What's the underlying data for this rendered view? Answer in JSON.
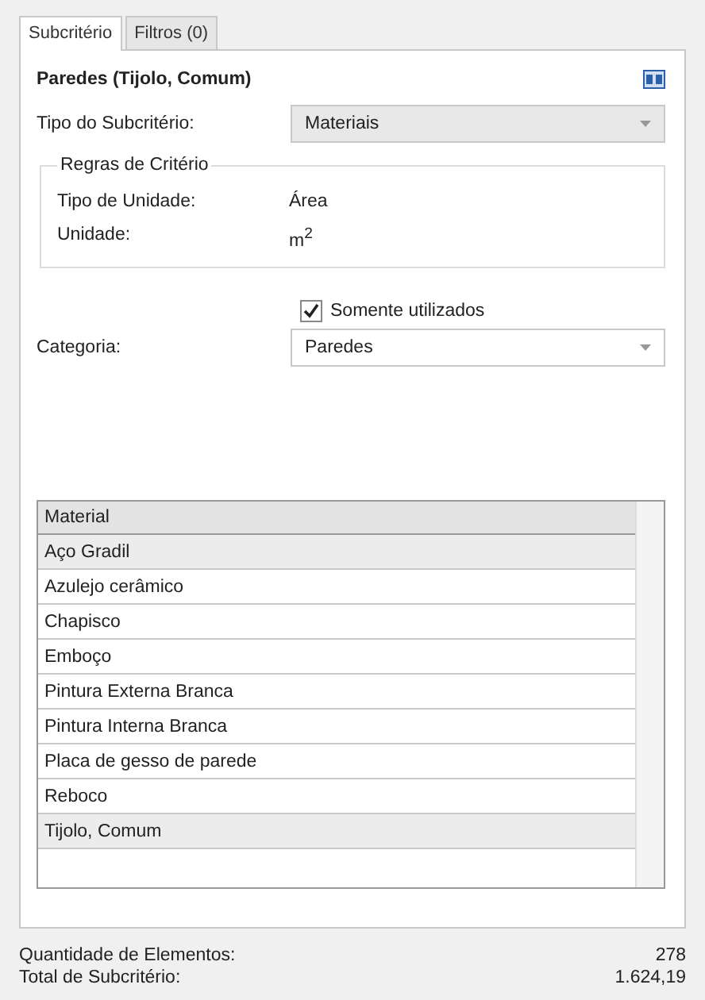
{
  "tabs": [
    {
      "label": "Subcritério",
      "selected": true
    },
    {
      "label": "Filtros (0)",
      "selected": false
    }
  ],
  "title": "Paredes (Tijolo, Comum)",
  "subcriterion_type": {
    "label": "Tipo do Subcritério:",
    "value": "Materiais"
  },
  "criteria_rules": {
    "legend": "Regras de Critério",
    "rows": [
      {
        "label": "Tipo de Unidade:",
        "value": "Área"
      },
      {
        "label": "Unidade:",
        "value": "m$^{2}$"
      }
    ]
  },
  "only_used": {
    "label": "Somente utilizados",
    "checked": true
  },
  "category": {
    "label": "Categoria:",
    "value": "Paredes"
  },
  "table": {
    "columns": [
      "Material"
    ],
    "rows": [
      {
        "cells": [
          "Aço Gradil"
        ],
        "selected": true
      },
      {
        "cells": [
          "Azulejo cerâmico"
        ],
        "selected": false
      },
      {
        "cells": [
          "Chapisco"
        ],
        "selected": false
      },
      {
        "cells": [
          "Emboço"
        ],
        "selected": false
      },
      {
        "cells": [
          "Pintura Externa Branca"
        ],
        "selected": false
      },
      {
        "cells": [
          "Pintura Interna Branca"
        ],
        "selected": false
      },
      {
        "cells": [
          "Placa de gesso de parede"
        ],
        "selected": false
      },
      {
        "cells": [
          "Reboco"
        ],
        "selected": false
      },
      {
        "cells": [
          "Tijolo, Comum"
        ],
        "selected": true
      }
    ]
  },
  "summary": [
    {
      "label": "Quantidade de Elementos:",
      "value": "278"
    },
    {
      "label": "Total de Subcritério:",
      "value": "1.624,19"
    }
  ]
}
